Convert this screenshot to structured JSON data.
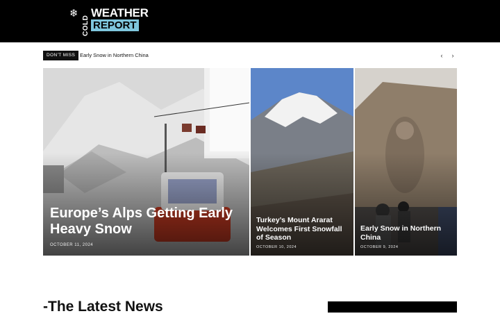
{
  "site": {
    "logo_top": "COLD",
    "logo_main": "WEATHER",
    "logo_sub": "REPORT",
    "snow_icon": "snowflake-icon"
  },
  "ticker": {
    "badge": "DON'T MISS",
    "headline": "Early Snow in Northern China",
    "prev_icon": "chevron-left-icon",
    "next_icon": "chevron-right-icon"
  },
  "featured": [
    {
      "title": "Europe’s Alps Getting Early Heavy Snow",
      "date": "OCTOBER 11, 2024"
    },
    {
      "title": "Turkey’s Mount Ararat Welcomes First Snowfall of Season",
      "date": "OCTOBER 10, 2024"
    },
    {
      "title": "Early Snow in Northern China",
      "date": "OCTOBER 9, 2024"
    }
  ],
  "latest": {
    "heading": "-The Latest News"
  },
  "colors": {
    "header_bg": "#000000",
    "logo_accent": "#7fc6dd"
  }
}
